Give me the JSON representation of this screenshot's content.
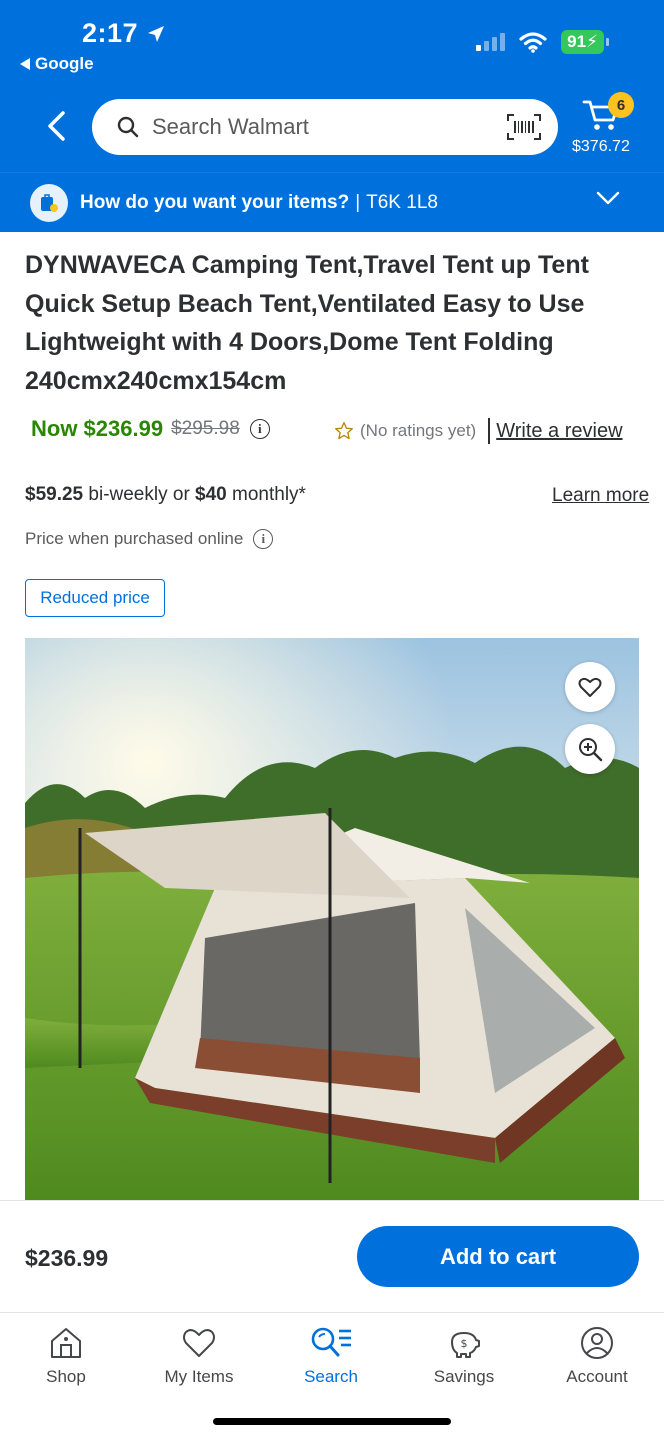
{
  "status_bar": {
    "time": "2:17",
    "back_app": "Google",
    "battery": "91"
  },
  "header": {
    "search_placeholder": "Search Walmart",
    "cart_count": "6",
    "cart_total": "$376.72"
  },
  "delivery": {
    "prompt": "How do you want your items?",
    "separator": "|",
    "postal_code": "T6K 1L8"
  },
  "product": {
    "title": "DYNWAVECA Camping Tent,Travel Tent up Tent Quick Setup Beach Tent,Ventilated Easy to Use Lightweight with 4 Doors,Dome Tent Folding 240cmx240cmx154cm",
    "price_now": "Now $236.99",
    "price_was": "$295.98",
    "ratings_text": "(No ratings yet)",
    "write_review": "Write a review",
    "financing_biweekly": "$59.25",
    "financing_mid": " bi-weekly or ",
    "financing_monthly": "$40",
    "financing_suffix": " monthly*",
    "learn_more": "Learn more",
    "price_online": "Price when purchased online",
    "badge": "Reduced price"
  },
  "cart_bar": {
    "price": "$236.99",
    "add_to_cart": "Add to cart"
  },
  "bottom_nav": [
    {
      "label": "Shop",
      "icon": "shop-icon"
    },
    {
      "label": "My Items",
      "icon": "heart-icon"
    },
    {
      "label": "Search",
      "icon": "search-icon",
      "active": true
    },
    {
      "label": "Savings",
      "icon": "piggy-bank-icon"
    },
    {
      "label": "Account",
      "icon": "account-icon"
    }
  ],
  "colors": {
    "brand_blue": "#0071dc",
    "sale_green": "#2a8703",
    "cart_badge": "#ffc220"
  }
}
